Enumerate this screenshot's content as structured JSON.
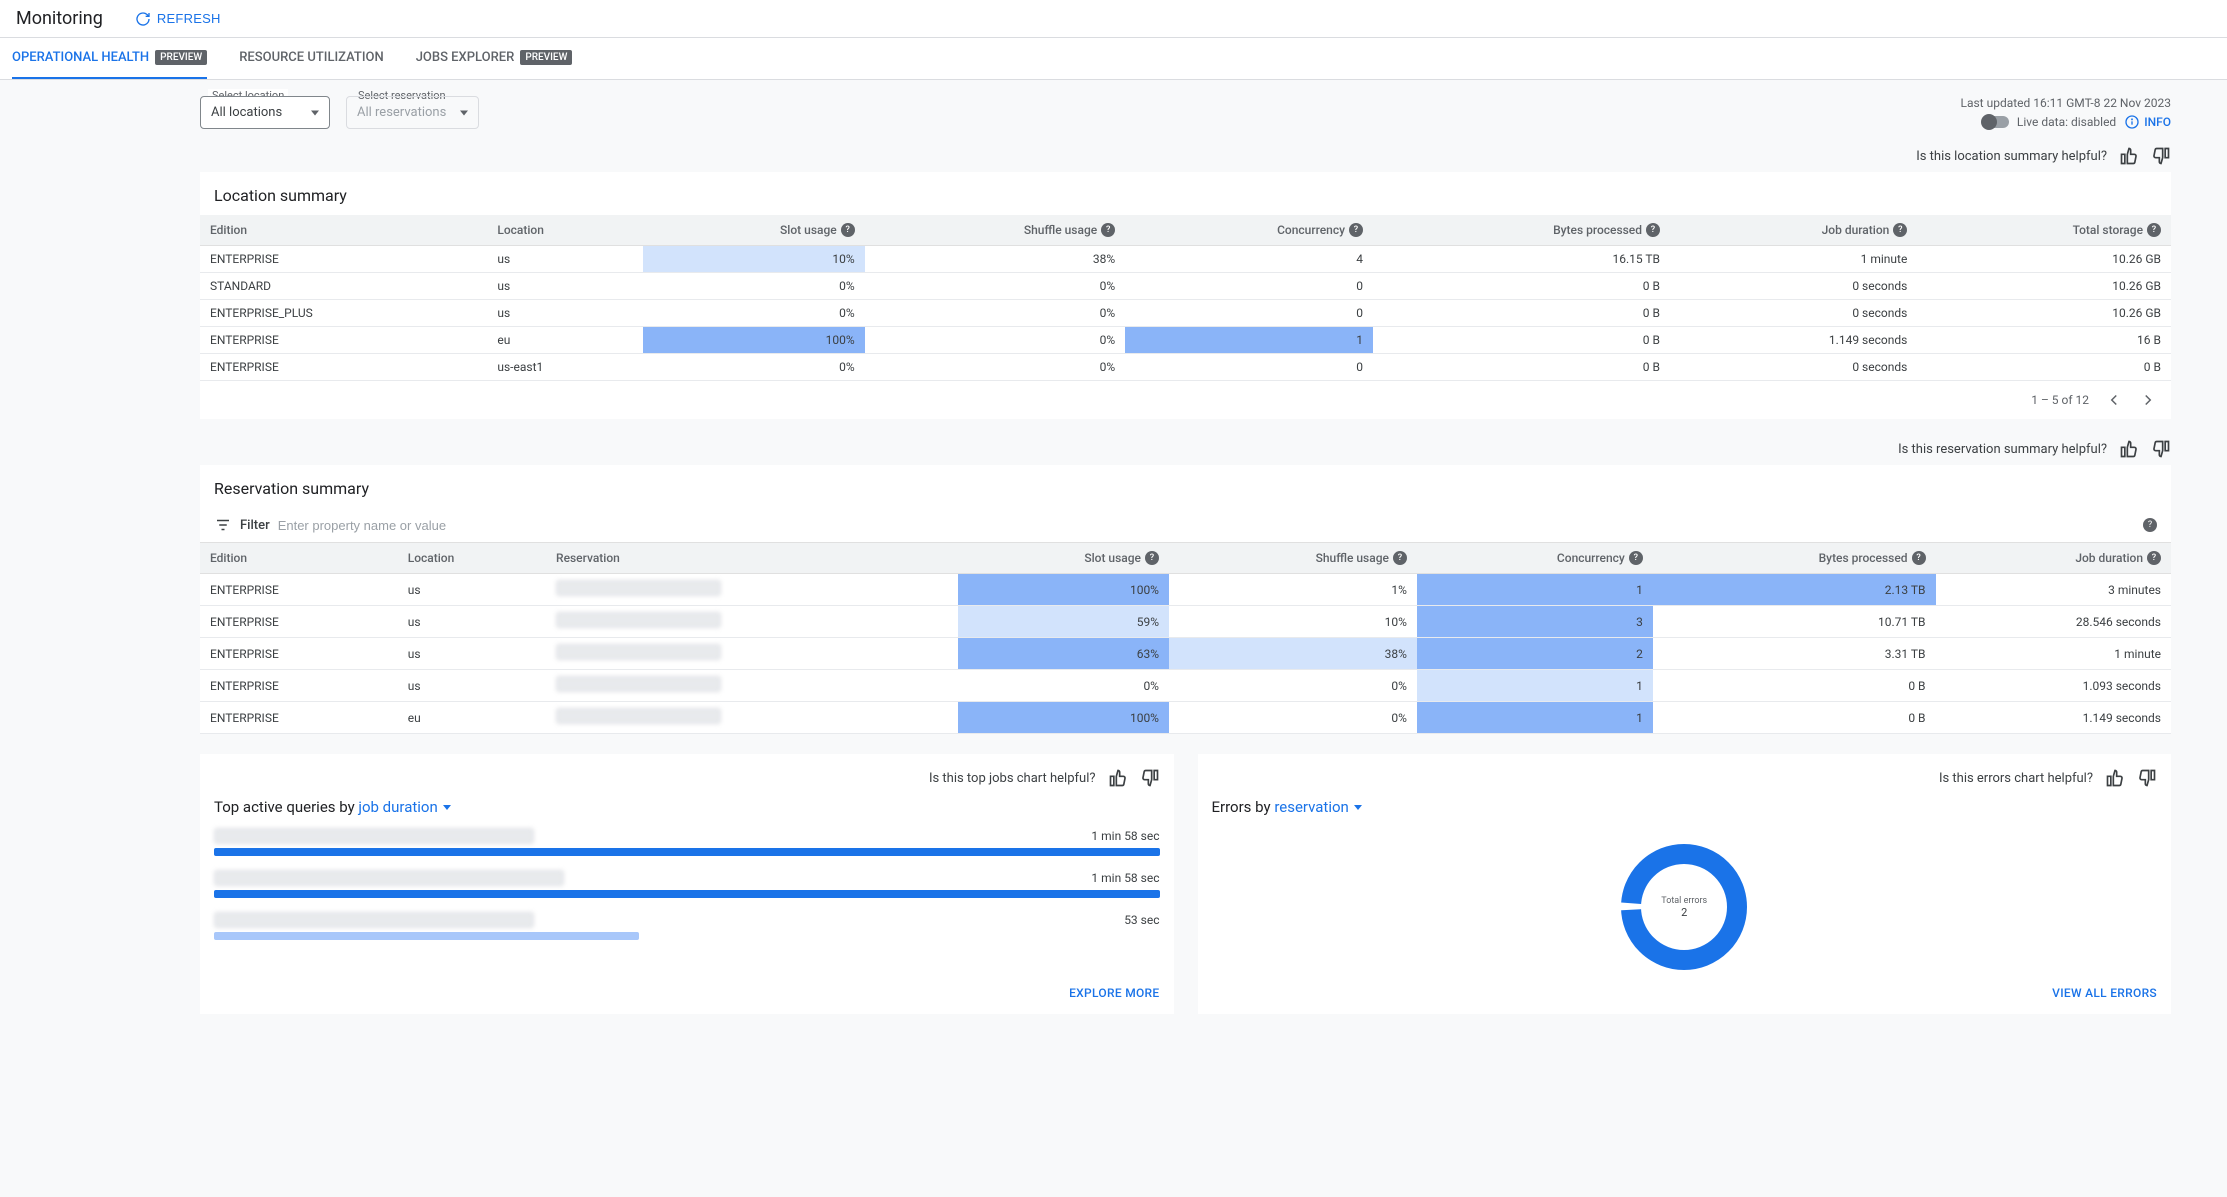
{
  "header": {
    "title": "Monitoring",
    "refresh": "REFRESH"
  },
  "tabs": [
    {
      "label": "OPERATIONAL HEALTH",
      "badge": "PREVIEW",
      "active": true
    },
    {
      "label": "RESOURCE UTILIZATION",
      "badge": null
    },
    {
      "label": "JOBS EXPLORER",
      "badge": "PREVIEW"
    }
  ],
  "filters": {
    "location_label": "Select location",
    "location_value": "All locations",
    "reservation_label": "Select reservation",
    "reservation_value": "All reservations"
  },
  "meta": {
    "last_updated": "Last updated 16:11 GMT-8 22 Nov 2023",
    "live_data_label": "Live data:",
    "live_data_state": "disabled",
    "info": "INFO"
  },
  "feedback": {
    "location": "Is this location summary helpful?",
    "reservation": "Is this reservation summary helpful?",
    "top_jobs": "Is this top jobs chart helpful?",
    "errors": "Is this errors chart helpful?"
  },
  "location_section": {
    "title": "Location summary",
    "columns": [
      "Edition",
      "Location",
      "Slot usage",
      "Shuffle usage",
      "Concurrency",
      "Bytes processed",
      "Job duration",
      "Total storage"
    ],
    "rows": [
      {
        "edition": "ENTERPRISE",
        "location": "us",
        "slot": "10%",
        "slot_heat": 0.1,
        "shuffle": "38%",
        "shuffle_heat": 0,
        "conc": "4",
        "conc_heat": 0,
        "bytes": "16.15 TB",
        "dur": "1 minute",
        "storage": "10.26 GB"
      },
      {
        "edition": "STANDARD",
        "location": "us",
        "slot": "0%",
        "slot_heat": 0,
        "shuffle": "0%",
        "shuffle_heat": 0,
        "conc": "0",
        "conc_heat": 0,
        "bytes": "0 B",
        "dur": "0 seconds",
        "storage": "10.26 GB"
      },
      {
        "edition": "ENTERPRISE_PLUS",
        "location": "us",
        "slot": "0%",
        "slot_heat": 0,
        "shuffle": "0%",
        "shuffle_heat": 0,
        "conc": "0",
        "conc_heat": 0,
        "bytes": "0 B",
        "dur": "0 seconds",
        "storage": "10.26 GB"
      },
      {
        "edition": "ENTERPRISE",
        "location": "eu",
        "slot": "100%",
        "slot_heat": 1.0,
        "shuffle": "0%",
        "shuffle_heat": 0,
        "conc": "1",
        "conc_heat": 1.0,
        "bytes": "0 B",
        "dur": "1.149 seconds",
        "storage": "16 B"
      },
      {
        "edition": "ENTERPRISE",
        "location": "us-east1",
        "slot": "0%",
        "slot_heat": 0,
        "shuffle": "0%",
        "shuffle_heat": 0,
        "conc": "0",
        "conc_heat": 0,
        "bytes": "0 B",
        "dur": "0 seconds",
        "storage": "0 B"
      }
    ],
    "pager": "1 – 5 of 12"
  },
  "reservation_section": {
    "title": "Reservation summary",
    "filter_label": "Filter",
    "filter_placeholder": "Enter property name or value",
    "columns": [
      "Edition",
      "Location",
      "Reservation",
      "Slot usage",
      "Shuffle usage",
      "Concurrency",
      "Bytes processed",
      "Job duration"
    ],
    "rows": [
      {
        "edition": "ENTERPRISE",
        "location": "us",
        "slot": "100%",
        "slot_heat": 1.0,
        "shuffle": "1%",
        "shuffle_heat": 0,
        "conc": "1",
        "conc_heat": 1.0,
        "bytes": "2.13 TB",
        "bytes_heat": 1.0,
        "dur": "3 minutes"
      },
      {
        "edition": "ENTERPRISE",
        "location": "us",
        "slot": "59%",
        "slot_heat": 0.25,
        "shuffle": "10%",
        "shuffle_heat": 0,
        "conc": "3",
        "conc_heat": 1.0,
        "bytes": "10.71 TB",
        "bytes_heat": 0,
        "dur": "28.546 seconds"
      },
      {
        "edition": "ENTERPRISE",
        "location": "us",
        "slot": "63%",
        "slot_heat": 1.0,
        "shuffle": "38%",
        "shuffle_heat": 0.25,
        "conc": "2",
        "conc_heat": 1.0,
        "bytes": "3.31 TB",
        "bytes_heat": 0,
        "dur": "1 minute"
      },
      {
        "edition": "ENTERPRISE",
        "location": "us",
        "slot": "0%",
        "slot_heat": 0,
        "shuffle": "0%",
        "shuffle_heat": 0,
        "conc": "1",
        "conc_heat": 0.25,
        "bytes": "0 B",
        "bytes_heat": 0,
        "dur": "1.093 seconds"
      },
      {
        "edition": "ENTERPRISE",
        "location": "eu",
        "slot": "100%",
        "slot_heat": 1.0,
        "shuffle": "0%",
        "shuffle_heat": 0,
        "conc": "1",
        "conc_heat": 1.0,
        "bytes": "0 B",
        "bytes_heat": 0,
        "dur": "1.149 seconds"
      }
    ]
  },
  "top_queries": {
    "title_prefix": "Top active queries by ",
    "title_link": "job duration",
    "rows": [
      {
        "dur": "1 min 58 sec",
        "pct": 100
      },
      {
        "dur": "1 min 58 sec",
        "pct": 100
      },
      {
        "dur": "53 sec",
        "pct": 45
      }
    ],
    "action": "EXPLORE MORE"
  },
  "errors_card": {
    "title_prefix": "Errors by ",
    "title_link": "reservation",
    "center_label": "Total errors",
    "center_value": "2",
    "action": "VIEW ALL ERRORS"
  },
  "heat_colors": {
    "strong": "#8ab4f8",
    "light": "#d2e3fc"
  }
}
